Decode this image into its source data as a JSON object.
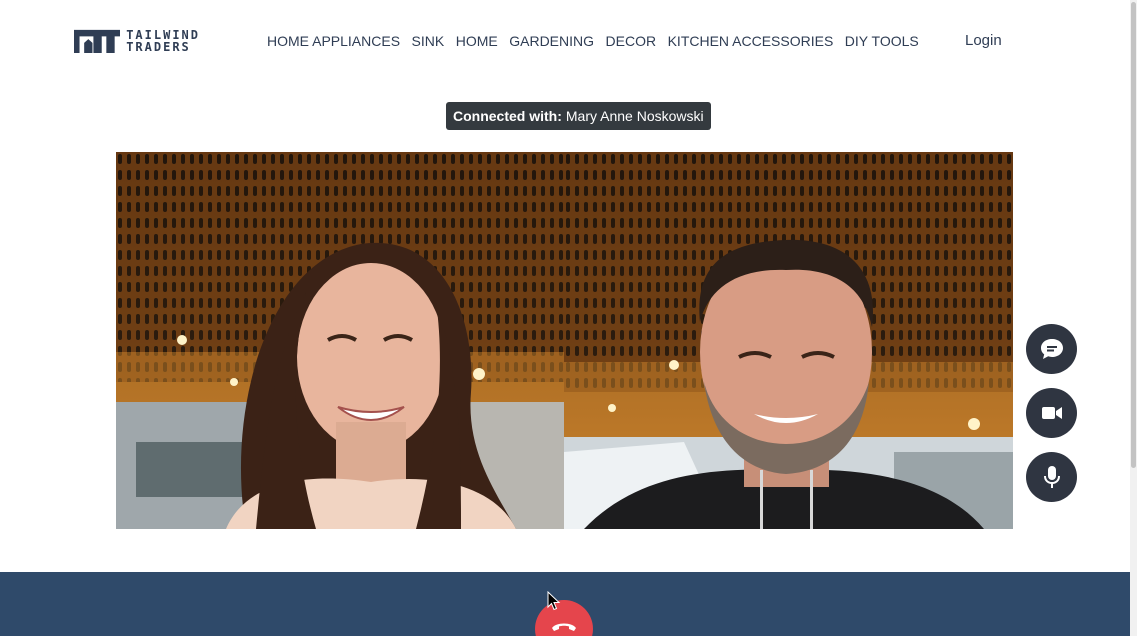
{
  "header": {
    "logo_line1": "TAILWIND",
    "logo_line2": "TRADERS",
    "nav": [
      {
        "label": "HOME APPLIANCES"
      },
      {
        "label": "SINK"
      },
      {
        "label": "HOME"
      },
      {
        "label": "GARDENING"
      },
      {
        "label": "DECOR"
      },
      {
        "label": "KITCHEN ACCESSORIES"
      },
      {
        "label": "DIY TOOLS"
      }
    ],
    "login_label": "Login"
  },
  "call": {
    "connected_label": "Connected with:",
    "connected_name": "Mary Anne Noskowski"
  },
  "controls": {
    "chat_icon": "chat-bubble-icon",
    "camera_icon": "video-camera-icon",
    "mic_icon": "microphone-icon",
    "hangup_icon": "phone-hangup-icon"
  },
  "colors": {
    "brand": "#2f3d54",
    "footer": "#2f4a6a",
    "control_bg": "#2f3541",
    "hangup": "#e5454c",
    "pill": "#343a3f"
  }
}
